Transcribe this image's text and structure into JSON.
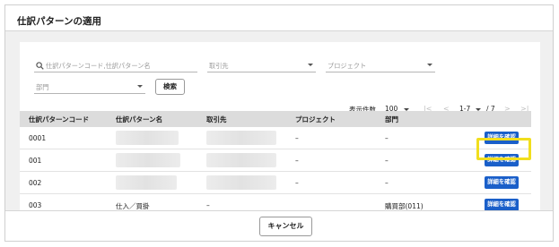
{
  "dialog": {
    "title": "仕訳パターンの適用"
  },
  "filters": {
    "search_placeholder": "仕訳パターンコード,仕訳パターン名",
    "partner_placeholder": "取引先",
    "project_placeholder": "プロジェクト",
    "department_placeholder": "部門",
    "search_button": "検索"
  },
  "pager": {
    "display_count_label": "表示件数",
    "page_size": "100",
    "range": "1-7",
    "total": "/ 7"
  },
  "table": {
    "headers": [
      "仕訳パターンコード",
      "仕訳パターン名",
      "取引先",
      "プロジェクト",
      "部門"
    ],
    "rows": [
      {
        "code": "0001",
        "name": "",
        "partner": "",
        "project": "–",
        "department": "–",
        "action": "詳細を確認"
      },
      {
        "code": "001",
        "name": "",
        "partner": "",
        "project": "–",
        "department": "–",
        "action": "詳細を確認"
      },
      {
        "code": "002",
        "name": "",
        "partner": "",
        "project": "–",
        "department": "–",
        "action": "詳細を確認"
      },
      {
        "code": "003",
        "name": "仕入／買掛",
        "partner": "–",
        "project": "",
        "department": "購買部(011)",
        "action": "詳細を確認"
      }
    ]
  },
  "footer": {
    "cancel_button": "キャンセル"
  },
  "colors": {
    "primary": "#1a5fc9",
    "highlight": "#f1de1e",
    "background": "#f0f0f0"
  }
}
